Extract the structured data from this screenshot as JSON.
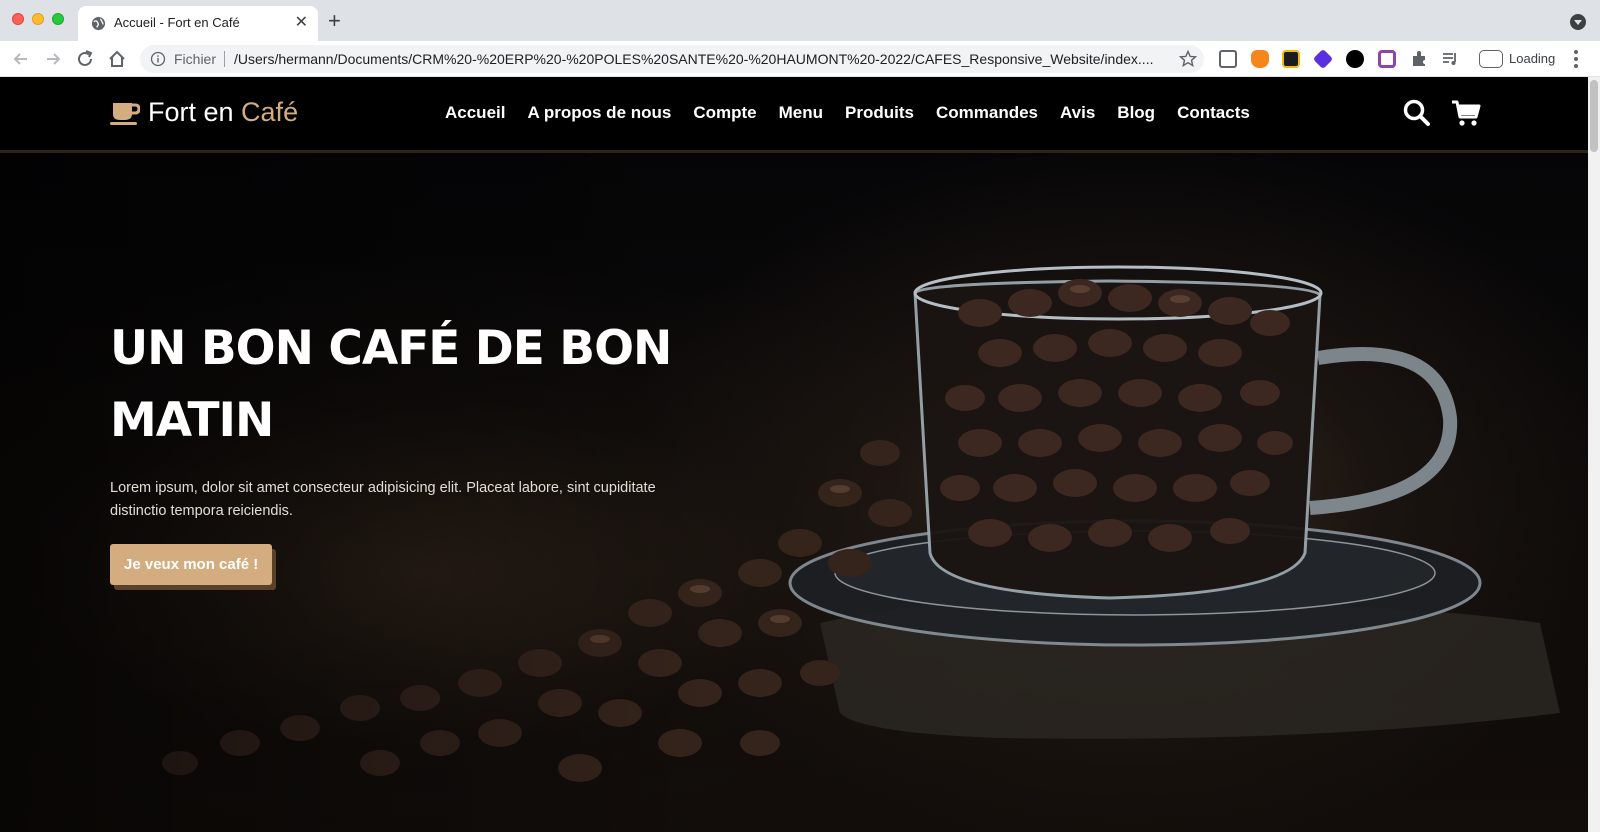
{
  "browser": {
    "tab_title": "Accueil - Fort en Café",
    "omnibox_label": "Fichier",
    "url": "/Users/hermann/Documents/CRM%20-%20ERP%20-%20POLES%20SANTE%20-%20HAUMONT%20-2022/CAFES_Responsive_Website/index....",
    "profile_status": "Loading",
    "icons": [
      "back-icon",
      "forward-icon",
      "reload-icon",
      "home-icon",
      "info-icon",
      "star-icon",
      "extensions-icon",
      "media-icon",
      "menu-icon"
    ]
  },
  "site": {
    "logo_main": "Fort en ",
    "logo_accent": "Café",
    "accent_color": "#d3ad7f",
    "nav": [
      "Accueil",
      "A propos de nous",
      "Compte",
      "Menu",
      "Produits",
      "Commandes",
      "Avis",
      "Blog",
      "Contacts"
    ]
  },
  "hero": {
    "title": "UN BON CAFÉ DE BON MATIN",
    "text": "Lorem ipsum, dolor sit amet consecteur adipisicing elit. Placeat labore, sint cupiditate distinctio tempora reiciendis.",
    "button": "Je veux mon café !"
  }
}
